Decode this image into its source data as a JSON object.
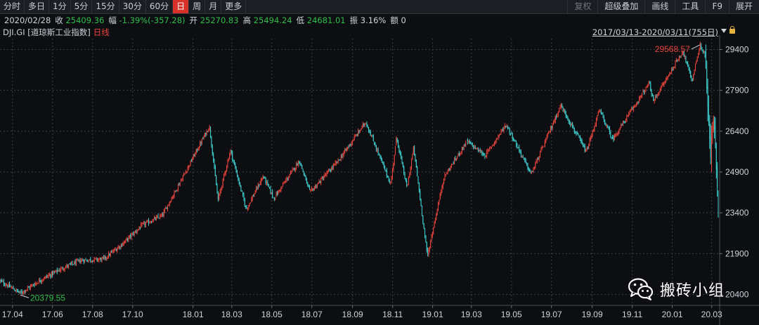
{
  "toolbar": {
    "period_tabs": [
      "分时",
      "多日",
      "1分",
      "5分",
      "15分",
      "30分",
      "60分",
      "日",
      "周",
      "月",
      "更多"
    ],
    "active_tab": "日",
    "tools": [
      "复权",
      "超级叠加",
      "画线",
      "工具",
      "F9",
      "展开"
    ]
  },
  "quote": {
    "date": "2020/02/28",
    "close_label": "收",
    "close": "25409.36",
    "change_label": "幅",
    "change": "-1.39%(-357.28)",
    "open_label": "开",
    "open": "25270.83",
    "high_label": "高",
    "high": "25494.24",
    "low_label": "低",
    "low": "24681.01",
    "amplitude_label": "振",
    "amplitude": "3.16%",
    "amount_label": "额",
    "amount": "0"
  },
  "title": {
    "symbol": "DJI.GI [道琼斯工业指数]",
    "kind": "日线",
    "range": "2017/03/13-2020/03/11(755日)"
  },
  "colors": {
    "up": "#e8453c",
    "down": "#3fd0cf",
    "background": "#0c0e12",
    "grid": "#3a3f48",
    "max_label": "#e8453c",
    "min_label": "#2fbf4a"
  },
  "chart_data": {
    "type": "candlestick",
    "y_ticks": [
      "29400",
      "27900",
      "26400",
      "24900",
      "23400",
      "21900",
      "20400"
    ],
    "y_range": [
      20000,
      29800
    ],
    "x_ticks": [
      "17.04",
      "17.06",
      "17.08",
      "17.10",
      "18.01",
      "18.03",
      "18.05",
      "18.07",
      "18.09",
      "18.11",
      "19.01",
      "19.03",
      "19.05",
      "19.07",
      "19.09",
      "19.11",
      "20.01",
      "20.03"
    ],
    "max_label": "29568.57",
    "min_label": "20379.55",
    "path": [
      [
        "2017-03-13",
        20900
      ],
      [
        "2017-04-13",
        20450
      ],
      [
        "2017-05-15",
        20950
      ],
      [
        "2017-06-19",
        21400
      ],
      [
        "2017-07-14",
        21650
      ],
      [
        "2017-08-18",
        21700
      ],
      [
        "2017-09-15",
        22250
      ],
      [
        "2017-10-16",
        22950
      ],
      [
        "2017-11-15",
        23300
      ],
      [
        "2017-12-15",
        24650
      ],
      [
        "2018-01-26",
        26580
      ],
      [
        "2018-02-08",
        23860
      ],
      [
        "2018-02-27",
        25700
      ],
      [
        "2018-03-23",
        23530
      ],
      [
        "2018-04-18",
        24750
      ],
      [
        "2018-05-04",
        23930
      ],
      [
        "2018-06-12",
        25320
      ],
      [
        "2018-06-28",
        24150
      ],
      [
        "2018-08-10",
        25300
      ],
      [
        "2018-09-21",
        26740
      ],
      [
        "2018-10-10",
        25600
      ],
      [
        "2018-10-29",
        24450
      ],
      [
        "2018-11-07",
        26180
      ],
      [
        "2018-11-23",
        24300
      ],
      [
        "2018-12-03",
        25800
      ],
      [
        "2018-12-24",
        21800
      ],
      [
        "2019-01-18",
        24700
      ],
      [
        "2019-02-22",
        26030
      ],
      [
        "2019-03-22",
        25500
      ],
      [
        "2019-04-23",
        26650
      ],
      [
        "2019-05-31",
        24820
      ],
      [
        "2019-07-15",
        27350
      ],
      [
        "2019-08-23",
        25630
      ],
      [
        "2019-09-12",
        27180
      ],
      [
        "2019-10-02",
        26100
      ],
      [
        "2019-11-27",
        28160
      ],
      [
        "2019-12-03",
        27500
      ],
      [
        "2020-01-17",
        29350
      ],
      [
        "2020-01-31",
        28250
      ],
      [
        "2020-02-12",
        29550
      ],
      [
        "2020-02-20",
        29200
      ],
      [
        "2020-02-28",
        25400
      ],
      [
        "2020-03-04",
        27100
      ],
      [
        "2020-03-11",
        23550
      ]
    ]
  },
  "watermark": {
    "icon": "wechat-icon",
    "text": "搬砖小组"
  }
}
